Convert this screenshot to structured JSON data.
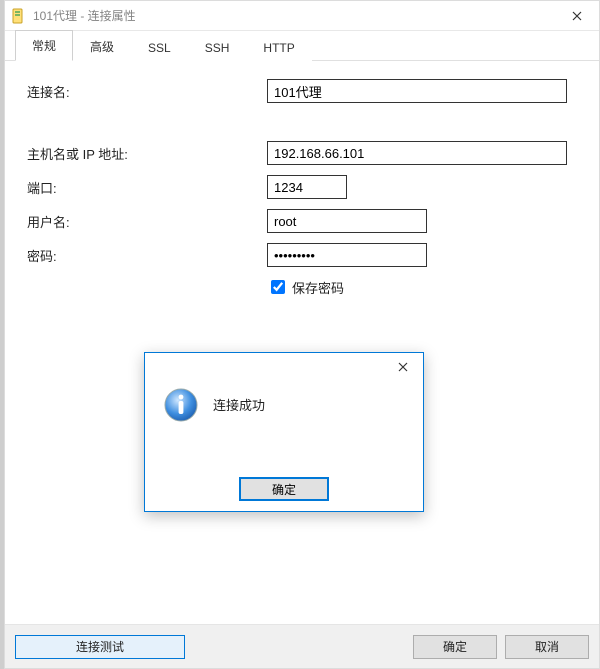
{
  "window": {
    "title": "101代理 - 连接属性"
  },
  "tabs": {
    "items": [
      "常规",
      "高级",
      "SSL",
      "SSH",
      "HTTP"
    ],
    "active_index": 0
  },
  "form": {
    "connection_name_label": "连接名:",
    "connection_name_value": "101代理",
    "host_label": "主机名或 IP 地址:",
    "host_value": "192.168.66.101",
    "port_label": "端口:",
    "port_value": "1234",
    "user_label": "用户名:",
    "user_value": "root",
    "password_label": "密码:",
    "password_value": "•••••••••",
    "save_password_label": "保存密码",
    "save_password_checked": true
  },
  "buttons": {
    "test": "连接测试",
    "ok": "确定",
    "cancel": "取消"
  },
  "dialog": {
    "message": "连接成功",
    "ok": "确定"
  }
}
